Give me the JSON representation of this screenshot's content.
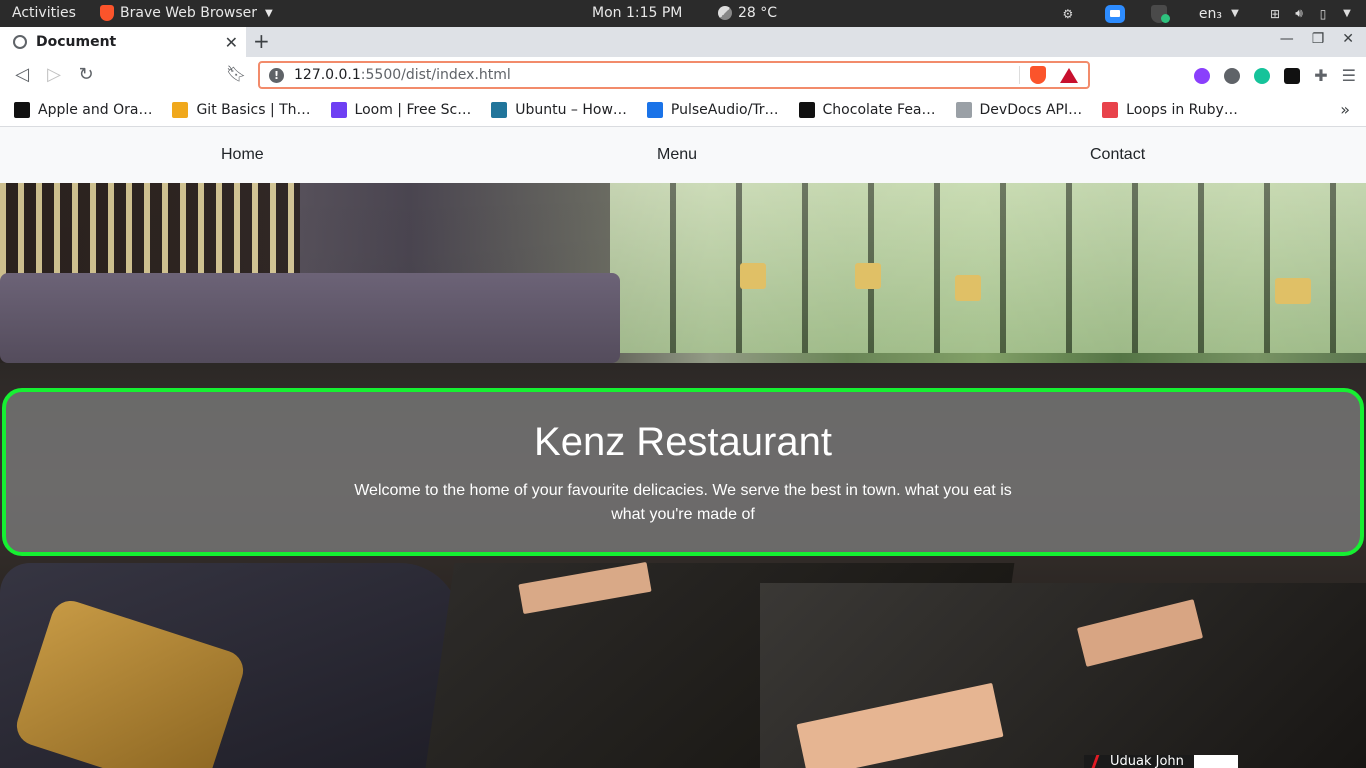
{
  "topbar": {
    "activities": "Activities",
    "app_name": "Brave Web Browser",
    "clock": "Mon  1:15 PM",
    "temperature": "28 °C",
    "lang": "en₃"
  },
  "tab": {
    "title": "Document"
  },
  "address": {
    "host": "127.0.0.1",
    "rest": ":5500/dist/index.html"
  },
  "bookmarks": [
    {
      "label": "Apple and Ora…",
      "color": "#111111"
    },
    {
      "label": "Git Basics | Th…",
      "color": "#f0a81c"
    },
    {
      "label": "Loom | Free Sc…",
      "color": "#6e3ff3"
    },
    {
      "label": "Ubuntu – How…",
      "color": "#21759b"
    },
    {
      "label": "PulseAudio/Tr…",
      "color": "#1a73e8"
    },
    {
      "label": "Chocolate Fea…",
      "color": "#111111"
    },
    {
      "label": "DevDocs API…",
      "color": "#9aa0a6"
    },
    {
      "label": "Loops in Ruby…",
      "color": "#e8424b"
    }
  ],
  "site": {
    "nav": {
      "home": "Home",
      "menu": "Menu",
      "contact": "Contact"
    },
    "hero": {
      "title": "Kenz Restaurant",
      "tagline": "Welcome to the home of your favourite delicacies. We serve the best in town. what you eat is what you're made of"
    }
  },
  "recorder": {
    "label": "Uduak John"
  }
}
